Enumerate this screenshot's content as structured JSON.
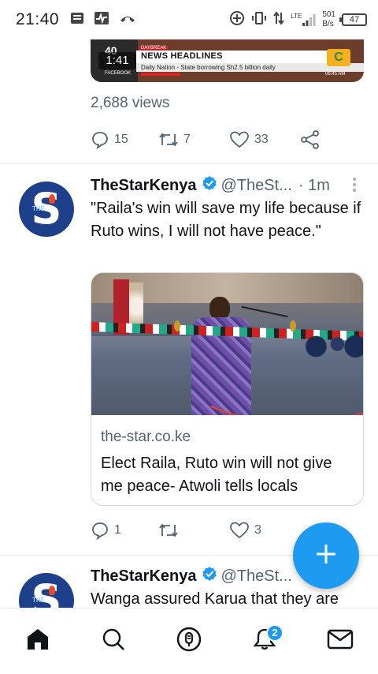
{
  "status_bar": {
    "time": "21:40",
    "network": "LTE",
    "speed_value": "501",
    "speed_unit": "B/s",
    "battery": "47"
  },
  "top_tweet": {
    "media": {
      "video_time": "1:41",
      "channel_number": "40",
      "daybreak": "DAYBREAK",
      "headline": "NEWS HEADLINES",
      "ticker": "Daily Nation - State borrowing Sh2.5 billion daily",
      "source": "FACEBOOK",
      "clock": "06:45 AM",
      "logo": "C"
    },
    "views": "2,688 views",
    "actions": {
      "replies": "15",
      "retweets": "7",
      "likes": "33"
    }
  },
  "tweet": {
    "name": "TheStarKenya",
    "handle": "@TheSt...",
    "separator": "·",
    "time": "1m",
    "text": "\"Raila's win will save my life because if Ruto wins, I will not have peace.\"",
    "card": {
      "domain": "the-star.co.ke",
      "title": "Elect Raila, Ruto win will not give me peace- Atwoli tells locals"
    },
    "actions": {
      "replies": "1",
      "retweets": "",
      "likes": "3"
    }
  },
  "next_tweet": {
    "name": "TheStarKenya",
    "handle": "@TheSt...",
    "text": "Wanga assured Karua that they are"
  },
  "avatar": {
    "letter": "S",
    "small_text": "THE"
  },
  "nav": {
    "notifications_badge": "2"
  },
  "colors": {
    "accent": "#1d9bf0",
    "muted": "#536471",
    "avatar_bg": "#1e3f8a"
  }
}
